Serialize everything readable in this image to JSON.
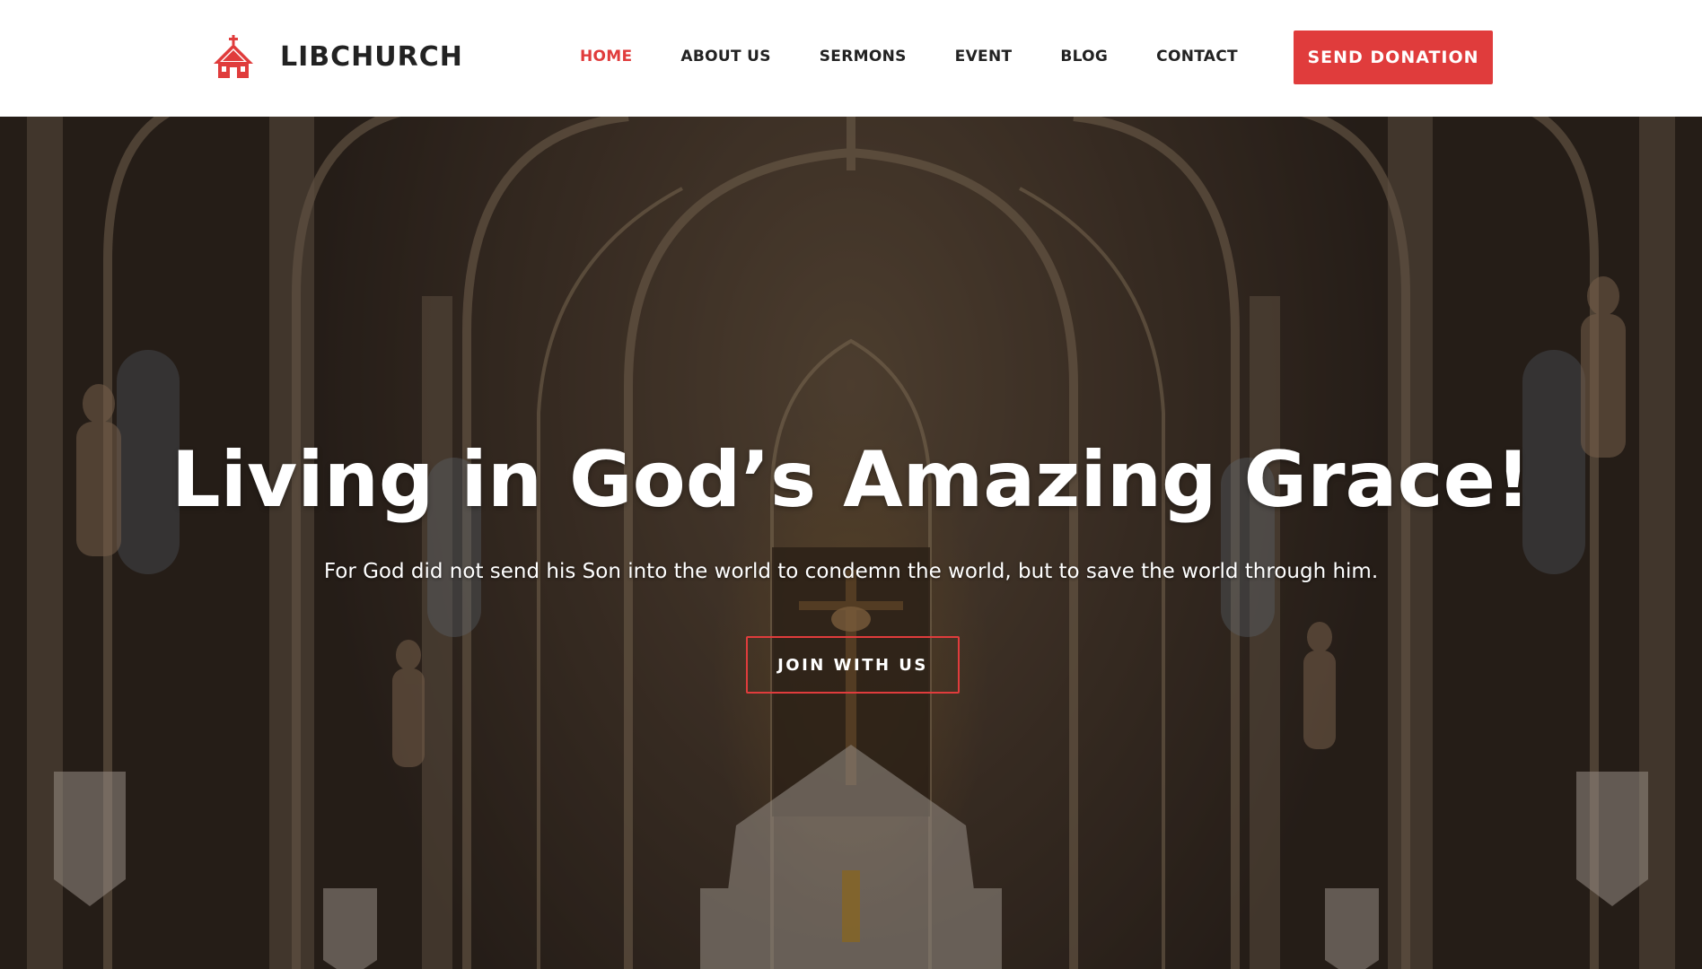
{
  "brand": {
    "name": "LIBCHURCH",
    "icon": "church-icon",
    "color": "#e03c3c"
  },
  "nav": {
    "items": [
      {
        "label": "HOME",
        "active": true
      },
      {
        "label": "ABOUT US",
        "active": false
      },
      {
        "label": "SERMONS",
        "active": false
      },
      {
        "label": "EVENT",
        "active": false
      },
      {
        "label": "BLOG",
        "active": false
      },
      {
        "label": "CONTACT",
        "active": false
      }
    ],
    "active_color": "#e03c3c",
    "text_color": "#222222"
  },
  "header": {
    "donate_label": "SEND DONATION"
  },
  "hero": {
    "title": "Living in God’s Amazing Grace!",
    "subtitle": "For God did not send his Son into the world to condemn the world, but to save the world through him.",
    "cta_label": "JOIN WITH US",
    "background": "church-interior-photo"
  }
}
